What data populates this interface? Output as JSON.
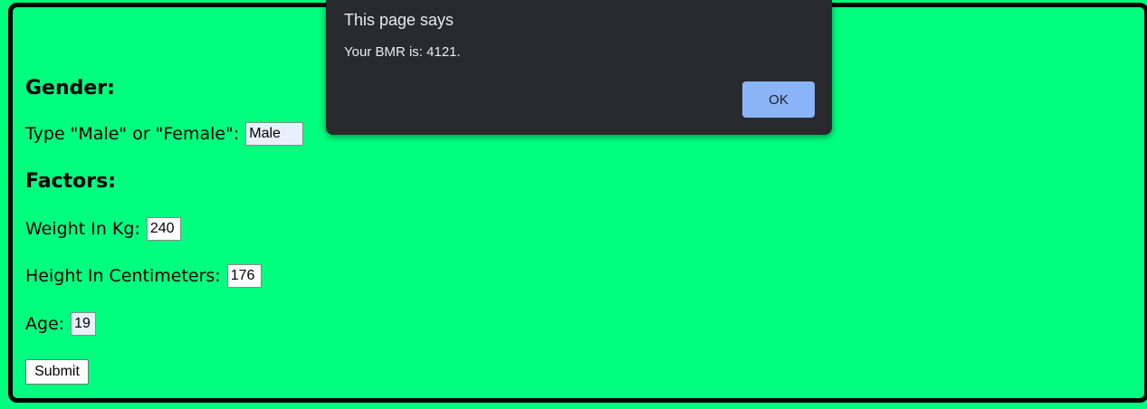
{
  "form": {
    "gender_heading": "Gender:",
    "gender_label": "Type \"Male\" or \"Female\":",
    "gender_value": "Male",
    "factors_heading": "Factors:",
    "weight_label": "Weight In Kg:",
    "weight_value": "240",
    "height_label": "Height In Centimeters:",
    "height_value": "176",
    "age_label": "Age:",
    "age_value": "19",
    "submit_label": "Submit"
  },
  "dialog": {
    "title": "This page says",
    "message": "Your BMR is: 4121.",
    "ok_label": "OK"
  },
  "colors": {
    "page_background": "#00ff7f",
    "dialog_background": "#292a2d",
    "ok_button": "#8ab4f8"
  }
}
